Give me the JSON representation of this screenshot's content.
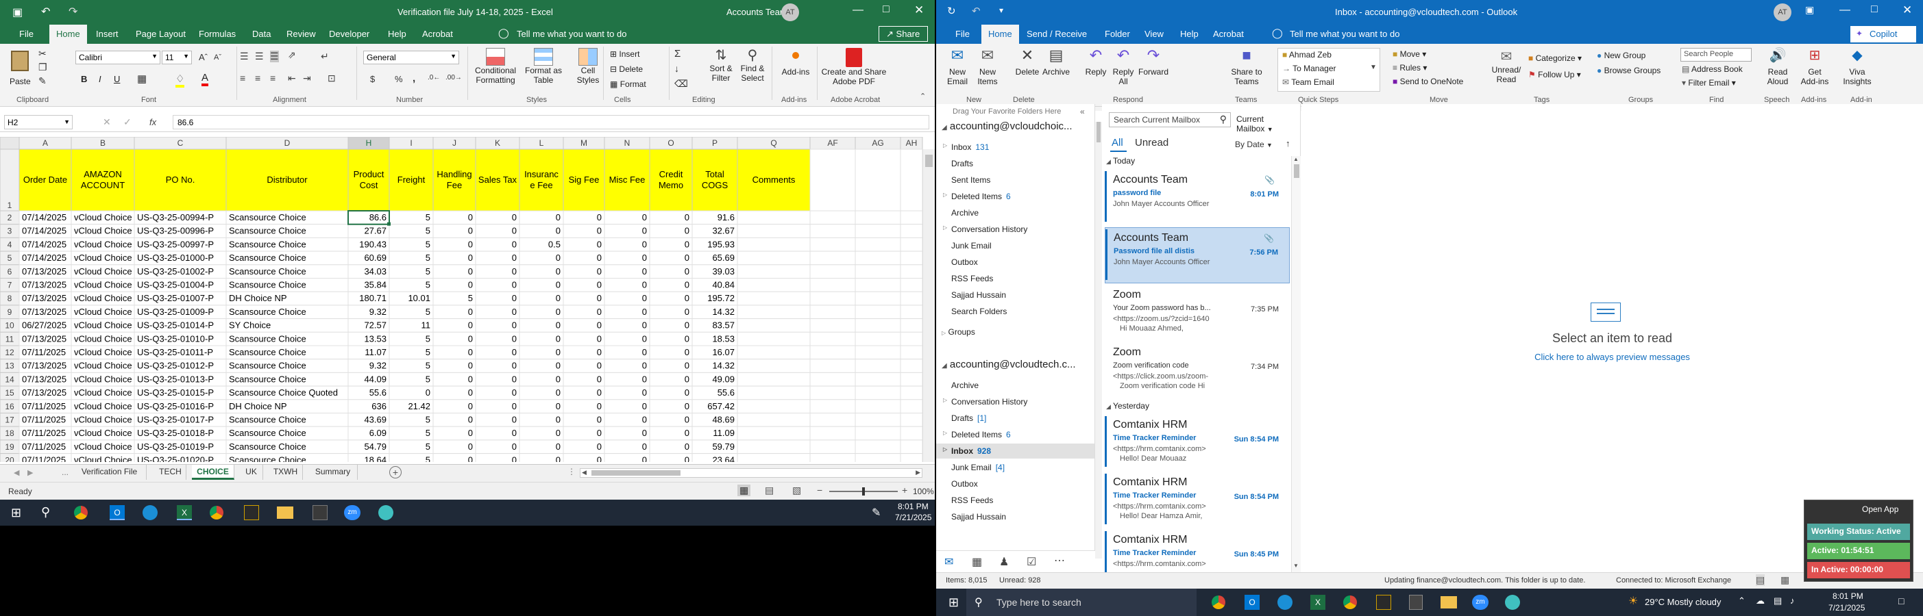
{
  "excel": {
    "title": "Verification file July 14-18, 2025  -  Excel",
    "account_name": "Accounts Team",
    "account_initials": "AT",
    "qat": {
      "save_icon": "save-icon",
      "undo_icon": "undo-icon",
      "redo_icon": "redo-icon"
    },
    "menus": [
      "File",
      "Home",
      "Insert",
      "Page Layout",
      "Formulas",
      "Data",
      "Review",
      "Developer",
      "Help",
      "Acrobat"
    ],
    "active_menu": "Home",
    "tell_me": "Tell me what you want to do",
    "share": "Share",
    "ribbon": {
      "paste": "Paste",
      "font_name": "Calibri",
      "font_size": "11",
      "number_format": "General",
      "cond_format": [
        "Conditional",
        "Formatting"
      ],
      "format_table": [
        "Format as",
        "Table"
      ],
      "cell_styles": [
        "Cell",
        "Styles"
      ],
      "insert": "Insert",
      "delete": "Delete",
      "format": "Format",
      "sort_filter": [
        "Sort &",
        "Filter"
      ],
      "find_select": [
        "Find &",
        "Select"
      ],
      "addins": "Add-ins",
      "create_pdf": [
        "Create and Share",
        "Adobe PDF"
      ],
      "groups": [
        "Clipboard",
        "Font",
        "Alignment",
        "Number",
        "Styles",
        "Cells",
        "Editing",
        "Add-ins",
        "Adobe Acrobat"
      ],
      "bold": "B",
      "italic": "I",
      "underline": "U",
      "font_a": "A",
      "currency": "$",
      "percent": "%",
      "comma": ","
    },
    "name_box": "H2",
    "formula_value": "86.6",
    "fx": "fx",
    "columns": [
      "A",
      "B",
      "C",
      "D",
      "H",
      "I",
      "J",
      "K",
      "L",
      "M",
      "N",
      "O",
      "P",
      "Q",
      "AF",
      "AG",
      "AH"
    ],
    "headers": [
      [
        "Order Date"
      ],
      [
        "AMAZON",
        "ACCOUNT"
      ],
      [
        "PO No."
      ],
      [
        "Distributor"
      ],
      [
        "Product",
        "Cost"
      ],
      [
        "Freight"
      ],
      [
        "Handling",
        "Fee"
      ],
      [
        "Sales Tax"
      ],
      [
        "Insuranc",
        "e Fee"
      ],
      [
        "Sig Fee"
      ],
      [
        "Misc Fee"
      ],
      [
        "Credit",
        "Memo"
      ],
      [
        "Total",
        "COGS"
      ],
      [
        "Comments"
      ]
    ],
    "rows": [
      [
        "2",
        "07/14/2025",
        "vCloud Choice",
        "US-Q3-25-00994-P",
        "Scansource Choice",
        "86.6",
        "5",
        "0",
        "0",
        "0",
        "0",
        "0",
        "0",
        "91.6"
      ],
      [
        "3",
        "07/14/2025",
        "vCloud Choice",
        "US-Q3-25-00996-P",
        "Scansource Choice",
        "27.67",
        "5",
        "0",
        "0",
        "0",
        "0",
        "0",
        "0",
        "32.67"
      ],
      [
        "4",
        "07/14/2025",
        "vCloud Choice",
        "US-Q3-25-00997-P",
        "Scansource Choice",
        "190.43",
        "5",
        "0",
        "0",
        "0.5",
        "0",
        "0",
        "0",
        "195.93"
      ],
      [
        "5",
        "07/14/2025",
        "vCloud Choice",
        "US-Q3-25-01000-P",
        "Scansource Choice",
        "60.69",
        "5",
        "0",
        "0",
        "0",
        "0",
        "0",
        "0",
        "65.69"
      ],
      [
        "6",
        "07/13/2025",
        "vCloud Choice",
        "US-Q3-25-01002-P",
        "Scansource Choice",
        "34.03",
        "5",
        "0",
        "0",
        "0",
        "0",
        "0",
        "0",
        "39.03"
      ],
      [
        "7",
        "07/13/2025",
        "vCloud Choice",
        "US-Q3-25-01004-P",
        "Scansource Choice",
        "35.84",
        "5",
        "0",
        "0",
        "0",
        "0",
        "0",
        "0",
        "40.84"
      ],
      [
        "8",
        "07/13/2025",
        "vCloud Choice",
        "US-Q3-25-01007-P",
        "DH Choice NP",
        "180.71",
        "10.01",
        "5",
        "0",
        "0",
        "0",
        "0",
        "0",
        "195.72"
      ],
      [
        "9",
        "07/13/2025",
        "vCloud Choice",
        "US-Q3-25-01009-P",
        "Scansource Choice",
        "9.32",
        "5",
        "0",
        "0",
        "0",
        "0",
        "0",
        "0",
        "14.32"
      ],
      [
        "10",
        "06/27/2025",
        "vCloud Choice",
        "US-Q3-25-01014-P",
        "SY Choice",
        "72.57",
        "11",
        "0",
        "0",
        "0",
        "0",
        "0",
        "0",
        "83.57"
      ],
      [
        "11",
        "07/13/2025",
        "vCloud Choice",
        "US-Q3-25-01010-P",
        "Scansource Choice",
        "13.53",
        "5",
        "0",
        "0",
        "0",
        "0",
        "0",
        "0",
        "18.53"
      ],
      [
        "12",
        "07/11/2025",
        "vCloud Choice",
        "US-Q3-25-01011-P",
        "Scansource Choice",
        "11.07",
        "5",
        "0",
        "0",
        "0",
        "0",
        "0",
        "0",
        "16.07"
      ],
      [
        "13",
        "07/13/2025",
        "vCloud Choice",
        "US-Q3-25-01012-P",
        "Scansource Choice",
        "9.32",
        "5",
        "0",
        "0",
        "0",
        "0",
        "0",
        "0",
        "14.32"
      ],
      [
        "14",
        "07/13/2025",
        "vCloud Choice",
        "US-Q3-25-01013-P",
        "Scansource Choice",
        "44.09",
        "5",
        "0",
        "0",
        "0",
        "0",
        "0",
        "0",
        "49.09"
      ],
      [
        "15",
        "07/13/2025",
        "vCloud Choice",
        "US-Q3-25-01015-P",
        "Scansource Choice Quoted",
        "55.6",
        "0",
        "0",
        "0",
        "0",
        "0",
        "0",
        "0",
        "55.6"
      ],
      [
        "16",
        "07/11/2025",
        "vCloud Choice",
        "US-Q3-25-01016-P",
        "DH Choice NP",
        "636",
        "21.42",
        "0",
        "0",
        "0",
        "0",
        "0",
        "0",
        "657.42"
      ],
      [
        "17",
        "07/11/2025",
        "vCloud Choice",
        "US-Q3-25-01017-P",
        "Scansource Choice",
        "43.69",
        "5",
        "0",
        "0",
        "0",
        "0",
        "0",
        "0",
        "48.69"
      ],
      [
        "18",
        "07/11/2025",
        "vCloud Choice",
        "US-Q3-25-01018-P",
        "Scansource Choice",
        "6.09",
        "5",
        "0",
        "0",
        "0",
        "0",
        "0",
        "0",
        "11.09"
      ],
      [
        "19",
        "07/11/2025",
        "vCloud Choice",
        "US-Q3-25-01019-P",
        "Scansource Choice",
        "54.79",
        "5",
        "0",
        "0",
        "0",
        "0",
        "0",
        "0",
        "59.79"
      ],
      [
        "20",
        "07/11/2025",
        "vCloud Choice",
        "US-Q3-25-01020-P",
        "Scansource Choice",
        "18.64",
        "5",
        "0",
        "0",
        "0",
        "0",
        "0",
        "0",
        "23.64"
      ]
    ],
    "sheet_tabs": [
      "Verification File",
      "TECH",
      "CHOICE",
      "UK",
      "TXWH",
      "Summary"
    ],
    "active_sheet": "CHOICE",
    "status_ready": "Ready",
    "zoom": "100%"
  },
  "outlook": {
    "title": "Inbox - accounting@vcloudtech.com  -  Outlook",
    "account_initials": "AT",
    "copilot": "Copilot",
    "menus": [
      "File",
      "Home",
      "Send / Receive",
      "Folder",
      "View",
      "Help",
      "Acrobat"
    ],
    "active_menu": "Home",
    "tell_me": "Tell me what you want to do",
    "ribbon": {
      "new_email": [
        "New",
        "Email"
      ],
      "new_items": [
        "New",
        "Items"
      ],
      "delete": "Delete",
      "archive": "Archive",
      "reply": "Reply",
      "reply_all": [
        "Reply",
        "All"
      ],
      "forward": "Forward",
      "share_teams": [
        "Share to",
        "Teams"
      ],
      "quick_steps": [
        "Ahmad Zeb",
        "To Manager",
        "Team Email"
      ],
      "move": "Move",
      "rules": "Rules",
      "onenote": "Send to OneNote",
      "unread_read": [
        "Unread/",
        "Read"
      ],
      "categorize": "Categorize",
      "follow_up": "Follow Up",
      "new_group": "New Group",
      "browse_groups": "Browse Groups",
      "search_people": "Search People",
      "address_book": "Address Book",
      "filter_email": "Filter Email",
      "read_aloud": [
        "Read",
        "Aloud"
      ],
      "get_addins": [
        "Get",
        "Add-ins"
      ],
      "viva": [
        "Viva",
        "Insights"
      ],
      "groups": [
        "New",
        "Delete",
        "Respond",
        "Teams",
        "Quick Steps",
        "Move",
        "Tags",
        "Groups",
        "Find",
        "Speech",
        "Add-ins",
        "Add-in"
      ]
    },
    "drag_favorites": "Drag Your Favorite Folders Here",
    "account1": "accounting@vcloudchoic...",
    "folders1": [
      {
        "name": "Inbox",
        "count": "131"
      },
      {
        "name": "Drafts",
        "count": ""
      },
      {
        "name": "Sent Items",
        "count": ""
      },
      {
        "name": "Deleted Items",
        "count": "6"
      },
      {
        "name": "Archive",
        "count": ""
      },
      {
        "name": "Conversation History",
        "count": ""
      },
      {
        "name": "Junk Email",
        "count": ""
      },
      {
        "name": "Outbox",
        "count": ""
      },
      {
        "name": "RSS Feeds",
        "count": ""
      },
      {
        "name": "Sajjad Hussain",
        "count": ""
      },
      {
        "name": "Search Folders",
        "count": ""
      }
    ],
    "groups_label": "Groups",
    "account2": "accounting@vcloudtech.c...",
    "folders2": [
      {
        "name": "Archive",
        "count": ""
      },
      {
        "name": "Conversation History",
        "count": ""
      },
      {
        "name": "Drafts",
        "count": "[1]"
      },
      {
        "name": "Deleted Items",
        "count": "6"
      },
      {
        "name": "Inbox",
        "count": "928"
      },
      {
        "name": "Junk Email",
        "count": "[4]"
      },
      {
        "name": "Outbox",
        "count": ""
      },
      {
        "name": "RSS Feeds",
        "count": ""
      },
      {
        "name": "Sajjad Hussain",
        "count": ""
      }
    ],
    "search_placeholder": "Search Current Mailbox",
    "mailbox_scope": "Current Mailbox",
    "filter_all": "All",
    "filter_unread": "Unread",
    "sort_by": "By Date",
    "today": "Today",
    "yesterday": "Yesterday",
    "messages": [
      {
        "sender": "Accounts Team",
        "subject": "password file",
        "preview": "John Mayer  Accounts Officer",
        "time": "8:01 PM",
        "attach": true
      },
      {
        "sender": "Accounts Team",
        "subject": "Password file all distis",
        "preview": "John Mayer  Accounts Officer",
        "time": "7:56 PM",
        "attach": true
      },
      {
        "sender": "Zoom",
        "subject": "Your Zoom password has b...",
        "preview": "<https://zoom.us/?zcid=1640",
        "preview2": "Hi Mouaaz Ahmed,",
        "time": "7:35 PM"
      },
      {
        "sender": "Zoom",
        "subject": "Zoom verification code",
        "preview": "<https://click.zoom.us/zoom-",
        "preview2": "Zoom verification code  Hi",
        "time": "7:34 PM"
      },
      {
        "sender": "Comtanix HRM",
        "subject": "Time Tracker Reminder",
        "preview": "<https://hrm.comtanix.com>",
        "preview2": "Hello!  Dear Mouaaz",
        "time": "Sun 8:54 PM"
      },
      {
        "sender": "Comtanix HRM",
        "subject": "Time Tracker Reminder",
        "preview": "<https://hrm.comtanix.com>",
        "preview2": "Hello!  Dear Hamza Amir,",
        "time": "Sun 8:54 PM"
      },
      {
        "sender": "Comtanix HRM",
        "subject": "Time Tracker Reminder",
        "preview": "<https://hrm.comtanix.com>",
        "preview2": "",
        "time": "Sun 8:45 PM"
      }
    ],
    "reading_title": "Select an item to read",
    "reading_link": "Click here to always preview messages",
    "status_items": "Items: 8,015",
    "status_unread": "Unread: 928",
    "status_updating": "Updating finance@vcloudtech.com.  This folder is up to date.",
    "status_connected": "Connected to: Microsoft Exchange",
    "widget": {
      "open_app": "Open App",
      "working": "Working Status: Active",
      "active": "Active: 01:54:51",
      "inactive": "In Active: 00:00:00"
    }
  },
  "taskbar_left": {
    "time": "8:01 PM",
    "date": "7/21/2025"
  },
  "taskbar_right": {
    "search": "Type here to search",
    "weather": "29°C  Mostly cloudy",
    "time": "8:01 PM",
    "date": "7/21/2025"
  },
  "colors": {
    "excel_green": "#217346",
    "outlook_blue": "#0f6cbd",
    "header_yellow": "#ffff00"
  }
}
